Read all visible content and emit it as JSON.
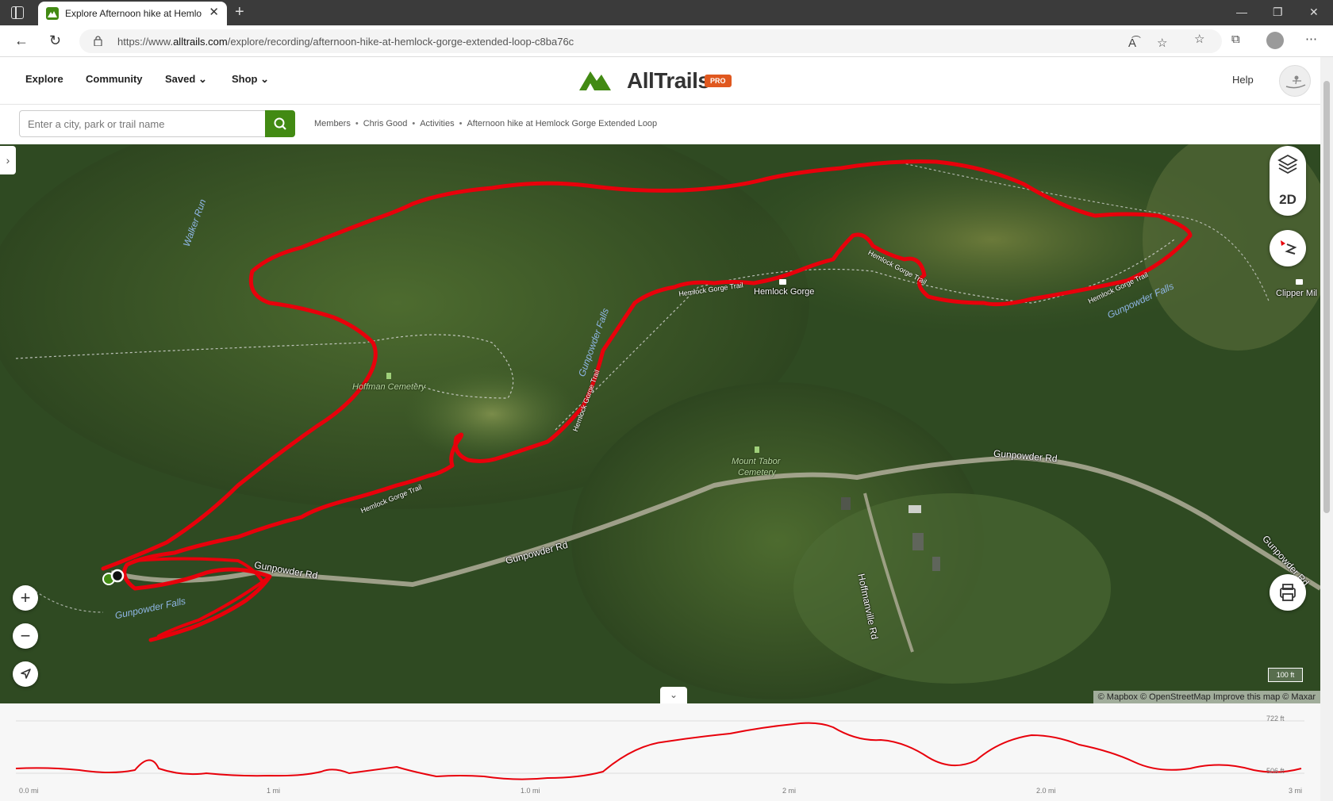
{
  "browser": {
    "tab_title": "Explore Afternoon hike at Hemlo",
    "url_prefix": "https://www.",
    "url_domain": "alltrails.com",
    "url_path": "/explore/recording/afternoon-hike-at-hemlock-gorge-extended-loop-c8ba76c"
  },
  "header": {
    "nav": [
      "Explore",
      "Community",
      "Saved",
      "Shop"
    ],
    "logo_text": "AllTrails",
    "pro_badge": "PRO",
    "help": "Help"
  },
  "search": {
    "placeholder": "Enter a city, park or trail name"
  },
  "breadcrumb": [
    "Members",
    "Chris Good",
    "Activities",
    "Afternoon hike at Hemlock Gorge Extended Loop"
  ],
  "map": {
    "labels": {
      "walker_run": "Walker Run",
      "hoffman_cemetery": "Hoffman Cemetery",
      "hemlock_gorge": "Hemlock Gorge",
      "clipper_mill": "Clipper Mil",
      "mount_tabor_cemetery_1": "Mount Tabor",
      "mount_tabor_cemetery_2": "Cemetery",
      "gunpowder_rd_1": "Gunpowder Rd",
      "gunpowder_rd_2": "Gunpowder Rd",
      "gunpowder_rd_3": "Gunpowder Rd",
      "gunpowder_rd_4": "Gunpowder Rd",
      "hoffmanville_rd": "Hoffmanville Rd",
      "gunpowder_falls_1": "Gunpowder Falls",
      "gunpowder_falls_2": "Gunpowder Falls",
      "gunpowder_falls_3": "Gunpowder Falls",
      "trail_1": "Hemlock Gorge Trail",
      "trail_2": "Hemlock Gorge Trail",
      "trail_3": "Hemlock Gorge Trail",
      "trail_4": "Hemlock Gorge Trail",
      "trail_5": "Hemlock Gorge Trail"
    },
    "view_mode": "2D",
    "scale": "100 ft",
    "attribution": "© Mapbox © OpenStreetMap  Improve this map © Maxar",
    "track_color": "#e8000b"
  },
  "elevation": {
    "max_label": "722 ft",
    "min_label": "506 ft",
    "x_ticks": [
      "0.0 mi",
      "1 mi",
      "1.0 mi",
      "2 mi",
      "2.0 mi",
      "3 mi"
    ]
  }
}
